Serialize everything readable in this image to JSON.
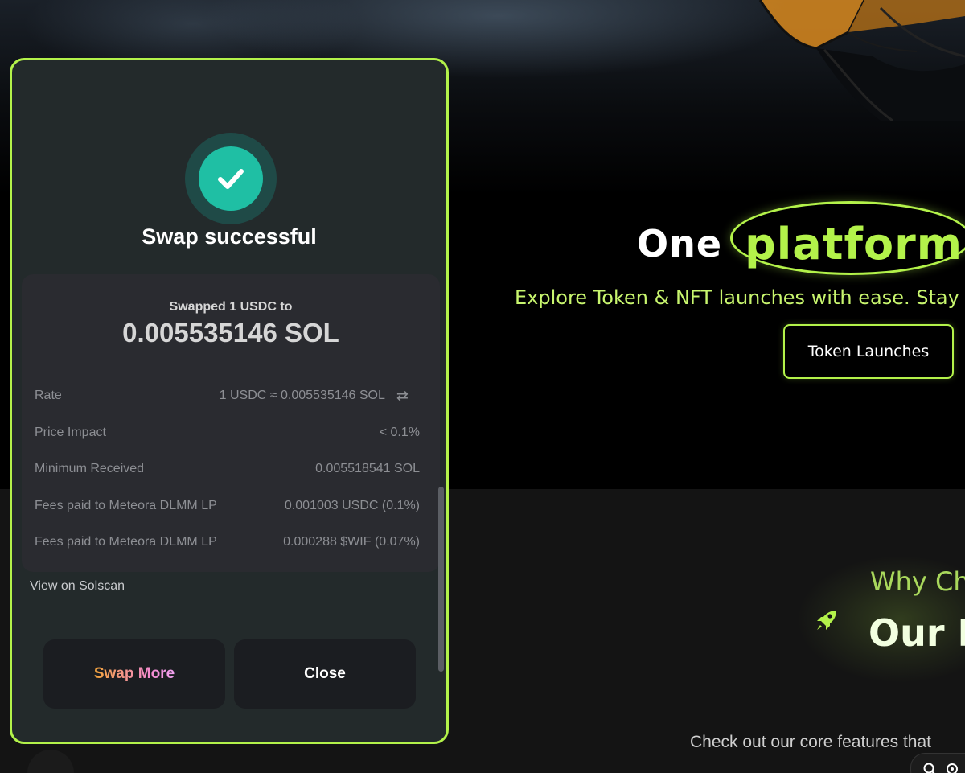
{
  "modal": {
    "title": "Swap successful",
    "swapped_label": "Swapped 1 USDC to",
    "swapped_amount": "0.005535146 SOL",
    "rows": [
      {
        "label": "Rate",
        "value": "1 USDC ≈ 0.005535146 SOL"
      },
      {
        "label": "Price Impact",
        "value": "< 0.1%"
      },
      {
        "label": "Minimum Received",
        "value": "0.005518541 SOL"
      },
      {
        "label": "Fees paid to Meteora DLMM LP",
        "value": "0.001003 USDC (0.1%)"
      },
      {
        "label": "Fees paid to Meteora DLMM LP",
        "value": "0.000288 $WIF (0.07%)"
      }
    ],
    "swap_direction_symbol": "⇄",
    "view_link": "View on Solscan",
    "swap_more_label": "Swap More",
    "close_label": "Close",
    "success_icon": "checkmark-icon"
  },
  "hero": {
    "title_word1": "One",
    "title_word2": "platform",
    "subtitle": "Explore Token & NFT launches with ease. Stay infor",
    "cta_label": "Token Launches"
  },
  "why": {
    "subtitle": "Why Ch",
    "title": "Our F",
    "icon": "rocket-icon"
  },
  "features_text": "Check out our core features that",
  "colors": {
    "accent": "#b3f24a",
    "success": "#1fbfa4",
    "modal_bg": "#232a2b",
    "panel_bg": "#2a2b30"
  }
}
